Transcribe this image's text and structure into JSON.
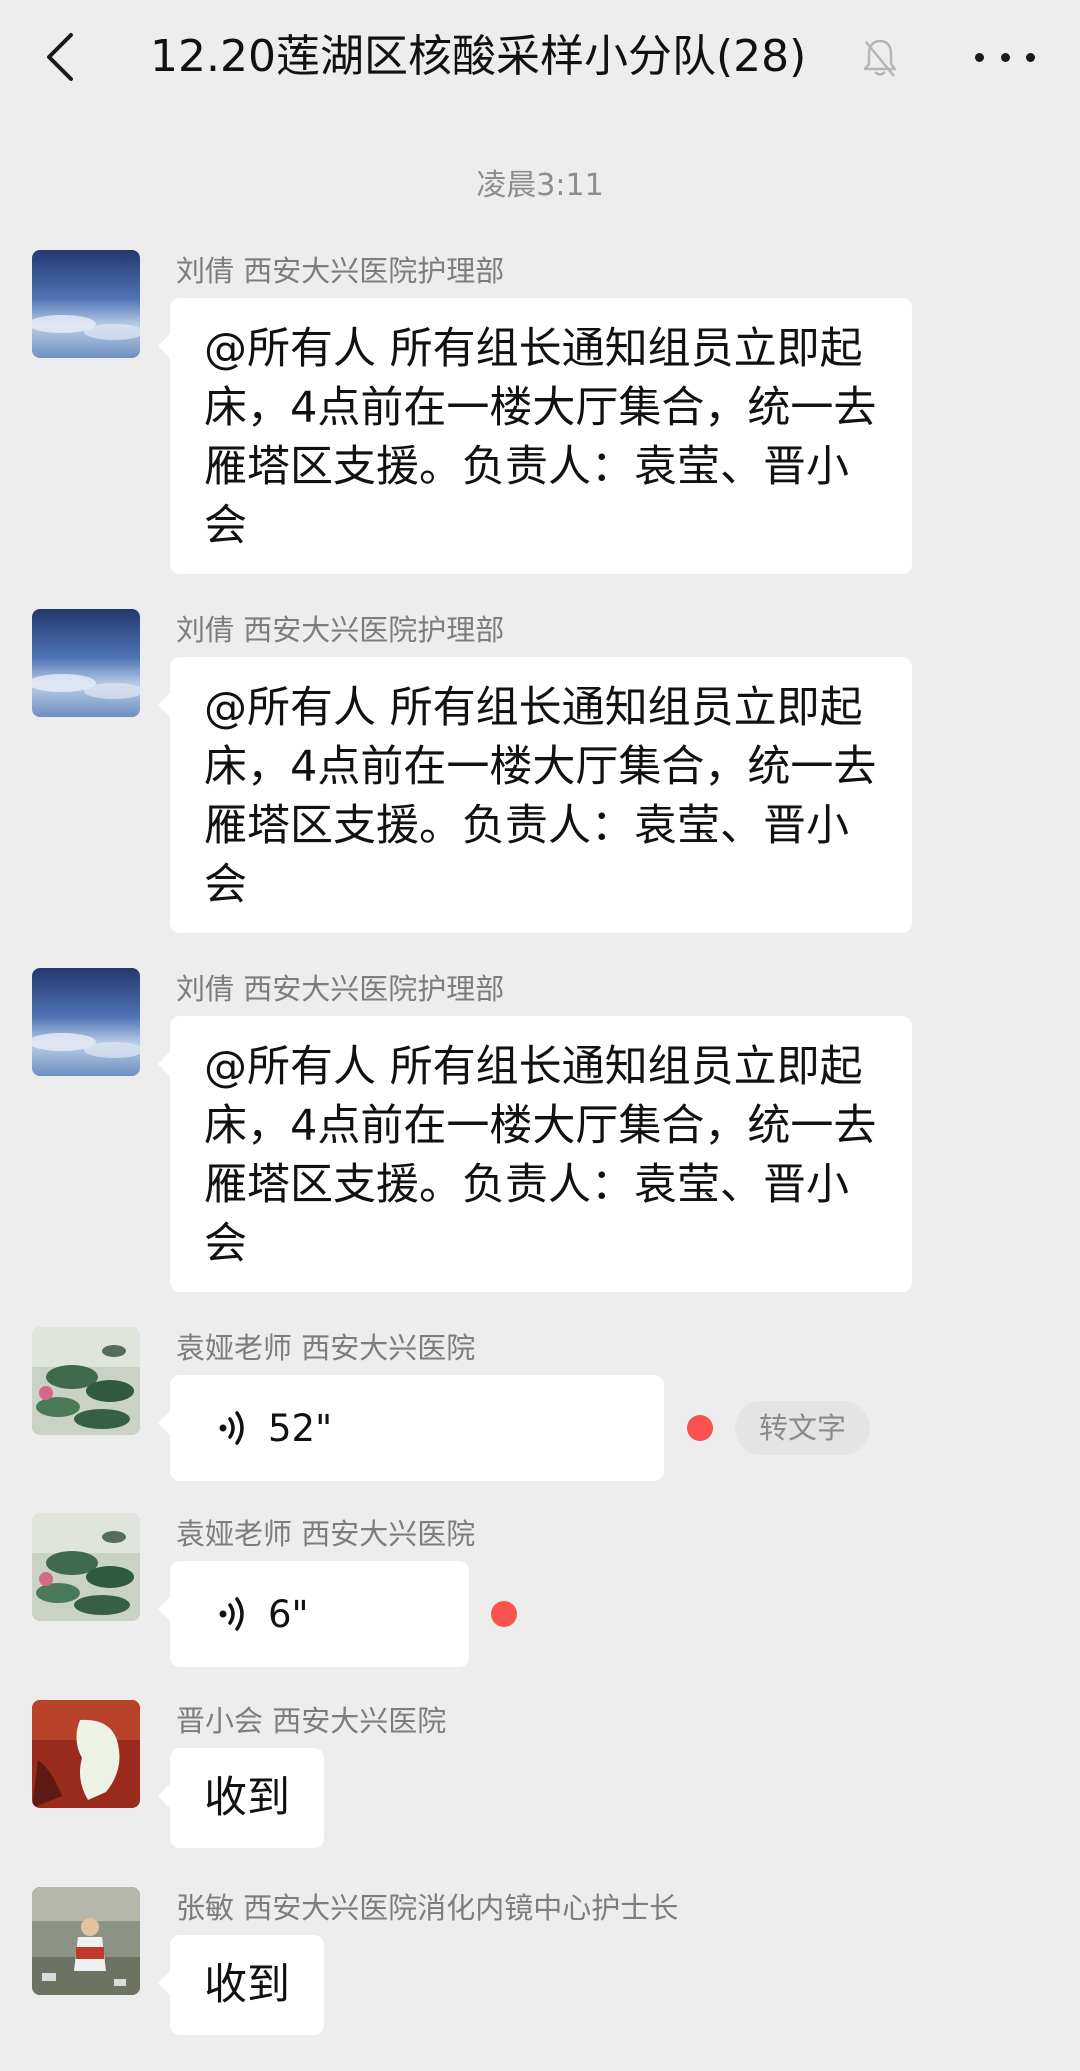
{
  "header": {
    "title": "12.20莲湖区核酸采样小分队(28)",
    "icons": [
      "back-chevron-icon",
      "bell-mute-icon",
      "more-icon"
    ]
  },
  "timestamp": "凌晨3:11",
  "messages": [
    {
      "sender": "刘倩  西安大兴医院护理部",
      "type": "text",
      "text": "@所有人  所有组长通知组员立即起床，4点前在一楼大厅集合，统一去雁塔区支援。负责人：袁莹、晋小会",
      "avatar": "sky-avatar"
    },
    {
      "sender": "刘倩  西安大兴医院护理部",
      "type": "text",
      "text": "@所有人  所有组长通知组员立即起床，4点前在一楼大厅集合，统一去雁塔区支援。负责人：袁莹、晋小会",
      "avatar": "sky-avatar"
    },
    {
      "sender": "刘倩  西安大兴医院护理部",
      "type": "text",
      "text": "@所有人  所有组长通知组员立即起床，4点前在一楼大厅集合，统一去雁塔区支援。负责人：袁莹、晋小会",
      "avatar": "sky-avatar"
    },
    {
      "sender": "袁娅老师  西安大兴医院",
      "type": "voice",
      "duration": "52\"",
      "convert_label": "转文字",
      "unread": true,
      "avatar": "lotus-avatar"
    },
    {
      "sender": "袁娅老师  西安大兴医院",
      "type": "voice",
      "duration": "6\"",
      "unread": true,
      "avatar": "lotus-avatar"
    },
    {
      "sender": "晋小会  西安大兴医院",
      "type": "text",
      "text": "收到",
      "avatar": "red-avatar"
    },
    {
      "sender": "张敏  西安大兴医院消化内镜中心护士长",
      "type": "text",
      "text": "收到",
      "avatar": "street-avatar"
    }
  ],
  "colors": {
    "background": "#ededed",
    "bubble": "#ffffff",
    "unread_dot": "#fa5151",
    "meta_text": "#8d8d8d"
  }
}
